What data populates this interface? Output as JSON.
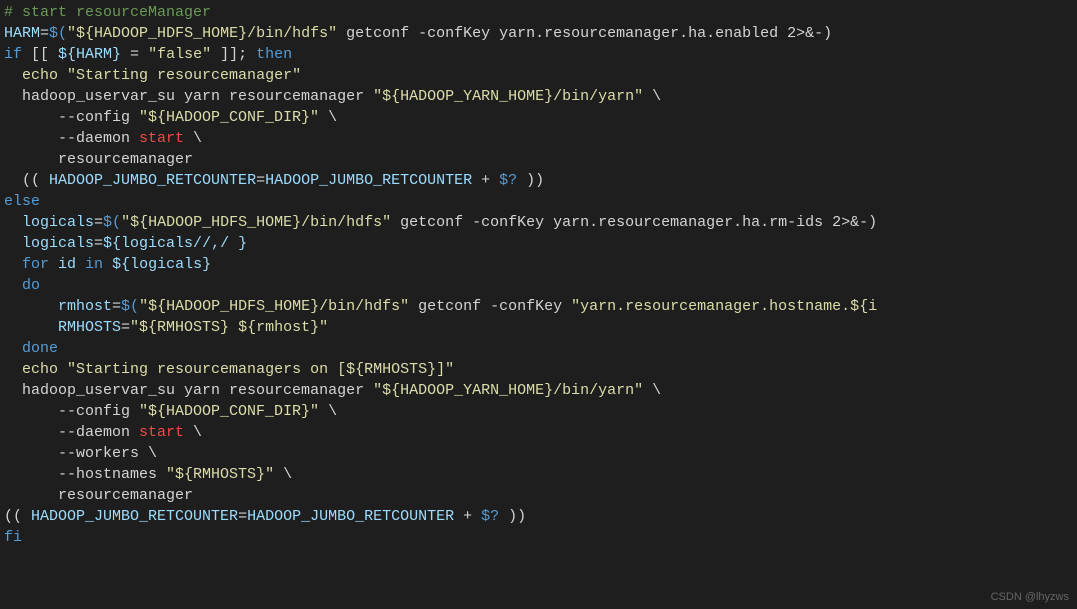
{
  "code": {
    "l1_comment": "# start resourceManager",
    "l2_var": "HARM",
    "l2_eq": "=",
    "l2_dollar_open": "$(",
    "l2_str1": "\"${HADOOP_HDFS_HOME}/bin/hdfs\"",
    "l2_args": " getconf -confKey yarn.resourcemanager.ha.enabled 2>&-)",
    "l3_if": "if",
    "l3_cond": " [[ ",
    "l3_var": "${HARM}",
    "l3_eq": " = ",
    "l3_val": "\"false\"",
    "l3_close": " ]]; ",
    "l3_then": "then",
    "l4_echo": "echo",
    "l4_str": " \"Starting resourcemanager\"",
    "l5_cmd": "hadoop_uservar_su yarn resourcemanager ",
    "l5_str": "\"${HADOOP_YARN_HOME}/bin/yarn\"",
    "l5_cont": " \\",
    "l6_config": "--config ",
    "l6_str": "\"${HADOOP_CONF_DIR}\"",
    "l6_cont": " \\",
    "l7_daemon": "--daemon ",
    "l7_start": "start",
    "l7_cont": " \\",
    "l8_rm": "resourcemanager",
    "l9_open": "(( ",
    "l9_var1": "HADOOP_JUMBO_RETCOUNTER",
    "l9_eq": "=",
    "l9_var2": "HADOOP_JUMBO_RETCOUNTER",
    "l9_plus": " + ",
    "l9_exit": "$?",
    "l9_close": " ))",
    "l10_else": "else",
    "l11_var": "logicals",
    "l11_eq": "=",
    "l11_dollar": "$(",
    "l11_str": "\"${HADOOP_HDFS_HOME}/bin/hdfs\"",
    "l11_args": " getconf -confKey yarn.resourcemanager.ha.rm-ids 2>&-)",
    "l12_var": "logicals",
    "l12_eq": "=",
    "l12_val": "${logicals//,/ }",
    "l13_for": "for",
    "l13_id": " id ",
    "l13_in": "in",
    "l13_var": " ${logicals}",
    "l14_do": "do",
    "l15_var": "rmhost",
    "l15_eq": "=",
    "l15_dollar": "$(",
    "l15_str": "\"${HADOOP_HDFS_HOME}/bin/hdfs\"",
    "l15_args": " getconf -confKey ",
    "l15_str2": "\"yarn.resourcemanager.hostname.${i",
    "l16_var": "RMHOSTS",
    "l16_eq": "=",
    "l16_str": "\"${RMHOSTS} ${rmhost}\"",
    "l17_done": "done",
    "l18_echo": "echo",
    "l18_str": " \"Starting resourcemanagers on [${RMHOSTS}]\"",
    "l19_cmd": "hadoop_uservar_su yarn resourcemanager ",
    "l19_str": "\"${HADOOP_YARN_HOME}/bin/yarn\"",
    "l19_cont": " \\",
    "l20_config": "--config ",
    "l20_str": "\"${HADOOP_CONF_DIR}\"",
    "l20_cont": " \\",
    "l21_daemon": "--daemon ",
    "l21_start": "start",
    "l21_cont": " \\",
    "l22_workers": "--workers \\",
    "l23_hostnames": "--hostnames ",
    "l23_str": "\"${RMHOSTS}\"",
    "l23_cont": " \\",
    "l24_rm": "resourcemanager",
    "l25_open": "(( ",
    "l25_var1": "HADOOP_JUMBO_RETCOUNTER",
    "l25_eq": "=",
    "l25_var2": "HADOOP_JUMBO_RETCOUNTER",
    "l25_plus": " + ",
    "l25_exit": "$?",
    "l25_close": " ))",
    "l26_fi": "fi"
  },
  "watermark": "CSDN @lhyzws"
}
